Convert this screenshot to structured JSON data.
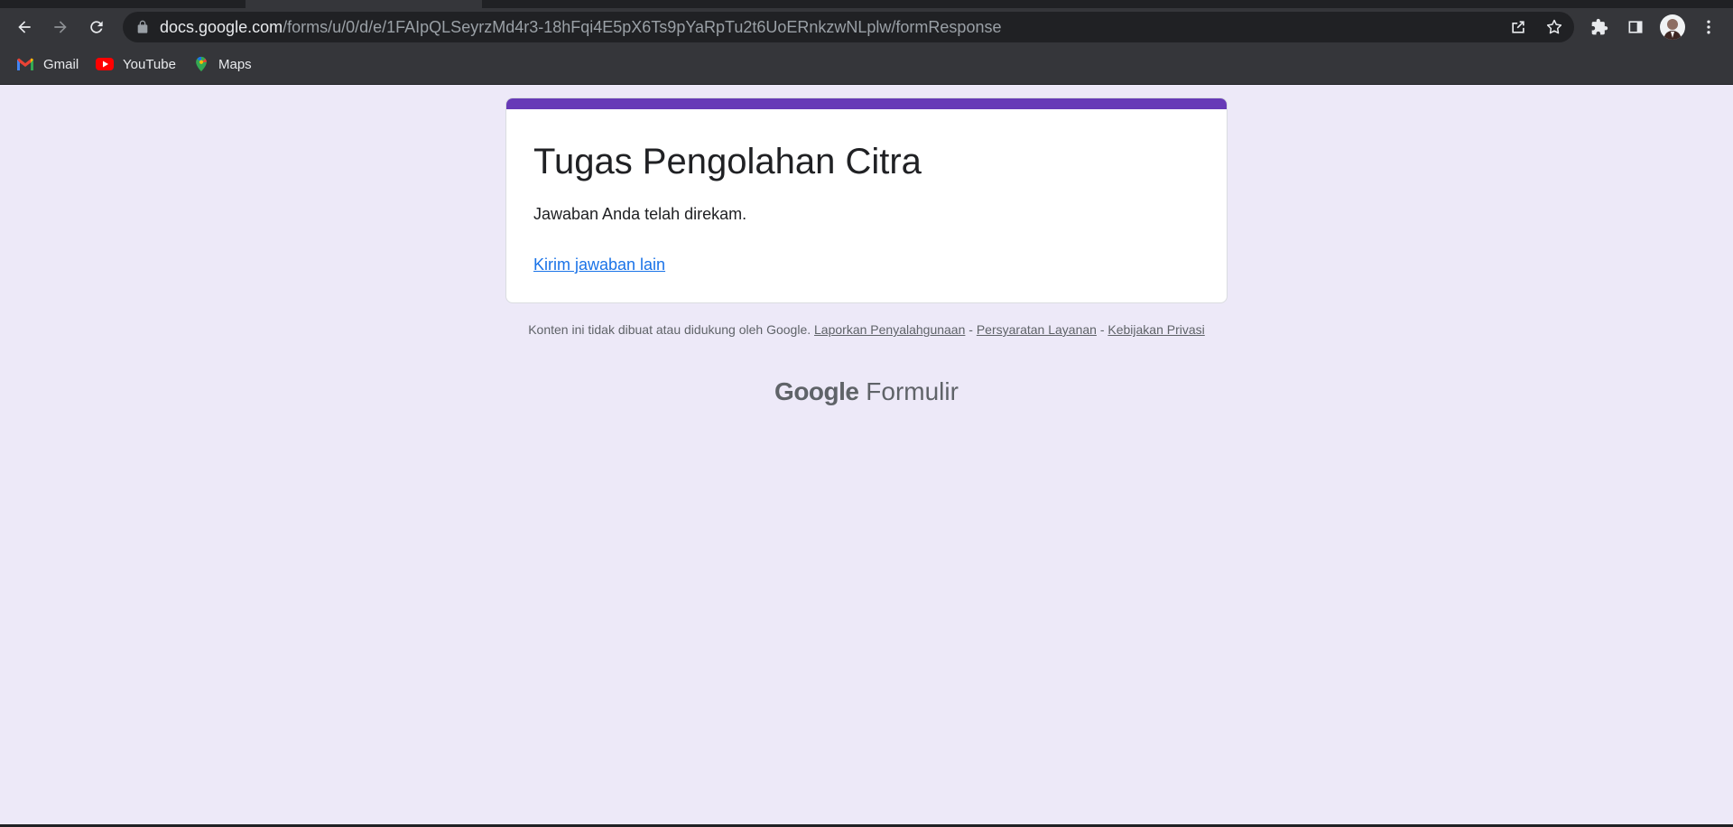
{
  "browser": {
    "url_host": "docs.google.com",
    "url_path": "/forms/u/0/d/e/1FAIpQLSeyrzMd4r3-18hFqi4E5pX6Ts9pYaRpTu2t6UoERnkzwNLplw/formResponse",
    "bookmarks": [
      {
        "label": "Gmail",
        "icon": "gmail-icon"
      },
      {
        "label": "YouTube",
        "icon": "youtube-icon"
      },
      {
        "label": "Maps",
        "icon": "maps-icon"
      }
    ],
    "colors": {
      "chrome": "#35363a",
      "omnibox": "#202124"
    }
  },
  "form": {
    "title": "Tugas Pengolahan Citra",
    "confirmation": "Jawaban Anda telah direkam.",
    "submit_another": "Kirim jawaban lain",
    "accent_color": "#673ab7",
    "background_color": "#ede9f8"
  },
  "footer": {
    "disclaimer": "Konten ini tidak dibuat atau didukung oleh Google.",
    "report_abuse": "Laporkan Penyalahgunaan",
    "terms": "Persyaratan Layanan",
    "privacy": "Kebijakan Privasi",
    "separator": "-"
  },
  "brand": {
    "google": "Google",
    "product": "Formulir"
  }
}
